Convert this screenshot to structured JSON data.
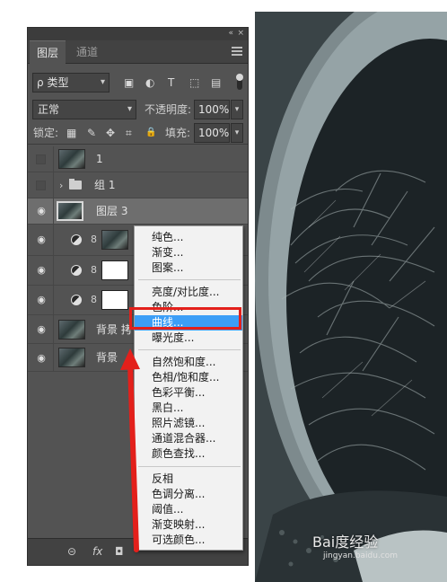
{
  "panel": {
    "collapse_glyph": "«",
    "close_glyph": "×",
    "tabs": [
      "图层",
      "通道"
    ],
    "filter": {
      "value": "类型",
      "search_glyph": "ρ"
    },
    "filter_icons": [
      "image-filter-icon",
      "adjustment-filter-icon",
      "type-filter-icon",
      "shape-filter-icon",
      "smart-object-filter-icon"
    ],
    "filter_glyphs": [
      "▣",
      "◐",
      "T",
      "⬚",
      "▤"
    ],
    "blend_mode": "正常",
    "opacity_label": "不透明度:",
    "opacity_value": "100%",
    "lock_label": "锁定:",
    "lock_glyphs": [
      "▦",
      "✎",
      "✥",
      "⌗",
      "🔒"
    ],
    "fill_label": "填充:",
    "fill_value": "100%",
    "caret": "▾",
    "layers": [
      {
        "name": "1",
        "visible": false,
        "type": "image"
      },
      {
        "name": "组 1",
        "visible": false,
        "type": "group",
        "chevron": "›"
      },
      {
        "name": "图层 3",
        "visible": true,
        "type": "image",
        "selected": true
      },
      {
        "name": "",
        "visible": true,
        "type": "adjustment",
        "mask": "image"
      },
      {
        "name": "",
        "visible": true,
        "type": "adjustment",
        "mask": "white"
      },
      {
        "name": "",
        "visible": true,
        "type": "adjustment",
        "mask": "white"
      },
      {
        "name": "背景 拷",
        "visible": true,
        "type": "image"
      },
      {
        "name": "背景",
        "visible": true,
        "type": "image"
      }
    ],
    "eye_glyph": "◉",
    "chain_glyph": "8",
    "bottom_icons": [
      "link-layers-icon",
      "fx-icon",
      "add-mask-icon"
    ],
    "bottom_glyphs": [
      "⊝",
      "fx",
      "◘"
    ]
  },
  "context_menu": {
    "items": [
      {
        "label": "纯色...",
        "sep_before": false
      },
      {
        "label": "渐变...",
        "sep_before": false
      },
      {
        "label": "图案...",
        "sep_before": false
      },
      {
        "label": "亮度/对比度...",
        "sep_before": true
      },
      {
        "label": "色阶...",
        "sep_before": false
      },
      {
        "label": "曲线...",
        "sep_before": false,
        "highlighted": true
      },
      {
        "label": "曝光度...",
        "sep_before": false
      },
      {
        "label": "自然饱和度...",
        "sep_before": true
      },
      {
        "label": "色相/饱和度...",
        "sep_before": false
      },
      {
        "label": "色彩平衡...",
        "sep_before": false
      },
      {
        "label": "黑白...",
        "sep_before": false
      },
      {
        "label": "照片滤镜...",
        "sep_before": false
      },
      {
        "label": "通道混合器...",
        "sep_before": false
      },
      {
        "label": "颜色查找...",
        "sep_before": false
      },
      {
        "label": "反相",
        "sep_before": true
      },
      {
        "label": "色调分离...",
        "sep_before": false
      },
      {
        "label": "阈值...",
        "sep_before": false
      },
      {
        "label": "渐变映射...",
        "sep_before": false
      },
      {
        "label": "可选颜色...",
        "sep_before": false
      }
    ],
    "highlight_color": "#3c9ef7"
  },
  "watermark": {
    "brand": "Bai度经验",
    "sub": "jingyan.baidu.com"
  },
  "colors": {
    "annotation_red": "#e3201b",
    "panel_bg": "#535353"
  }
}
